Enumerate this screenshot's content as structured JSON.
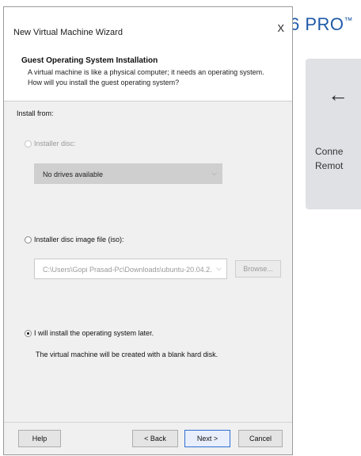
{
  "background_app": {
    "brand_text": "6 PRO",
    "brand_mark": "™",
    "tile_arrow": "←",
    "tile_line1": "Conne",
    "tile_line2": "Remot"
  },
  "wizard": {
    "title": "New Virtual Machine Wizard",
    "close_glyph": "x",
    "header": {
      "title": "Guest Operating System Installation",
      "description": "A virtual machine is like a physical computer; it needs an operating system. How will you install the guest operating system?"
    },
    "install_from_label": "Install from:",
    "options": {
      "installer_disc": {
        "label": "Installer disc:",
        "selected": false,
        "enabled": false,
        "dropdown_value": "No drives available"
      },
      "iso_image": {
        "label": "Installer disc image file (iso):",
        "selected": false,
        "path_value": "C:\\Users\\Gopi Prasad-Pc\\Downloads\\ubuntu-20.04.2.",
        "browse_label": "Browse..."
      },
      "install_later": {
        "label": "I will install the operating system later.",
        "selected": true,
        "description": "The virtual machine will be created with a blank hard disk."
      }
    },
    "buttons": {
      "help": "Help",
      "back": "< Back",
      "next": "Next >",
      "cancel": "Cancel"
    }
  },
  "colors": {
    "accent": "#2f6fd1",
    "brand": "#1f5aa8",
    "window_bg": "#f0f0f0"
  }
}
